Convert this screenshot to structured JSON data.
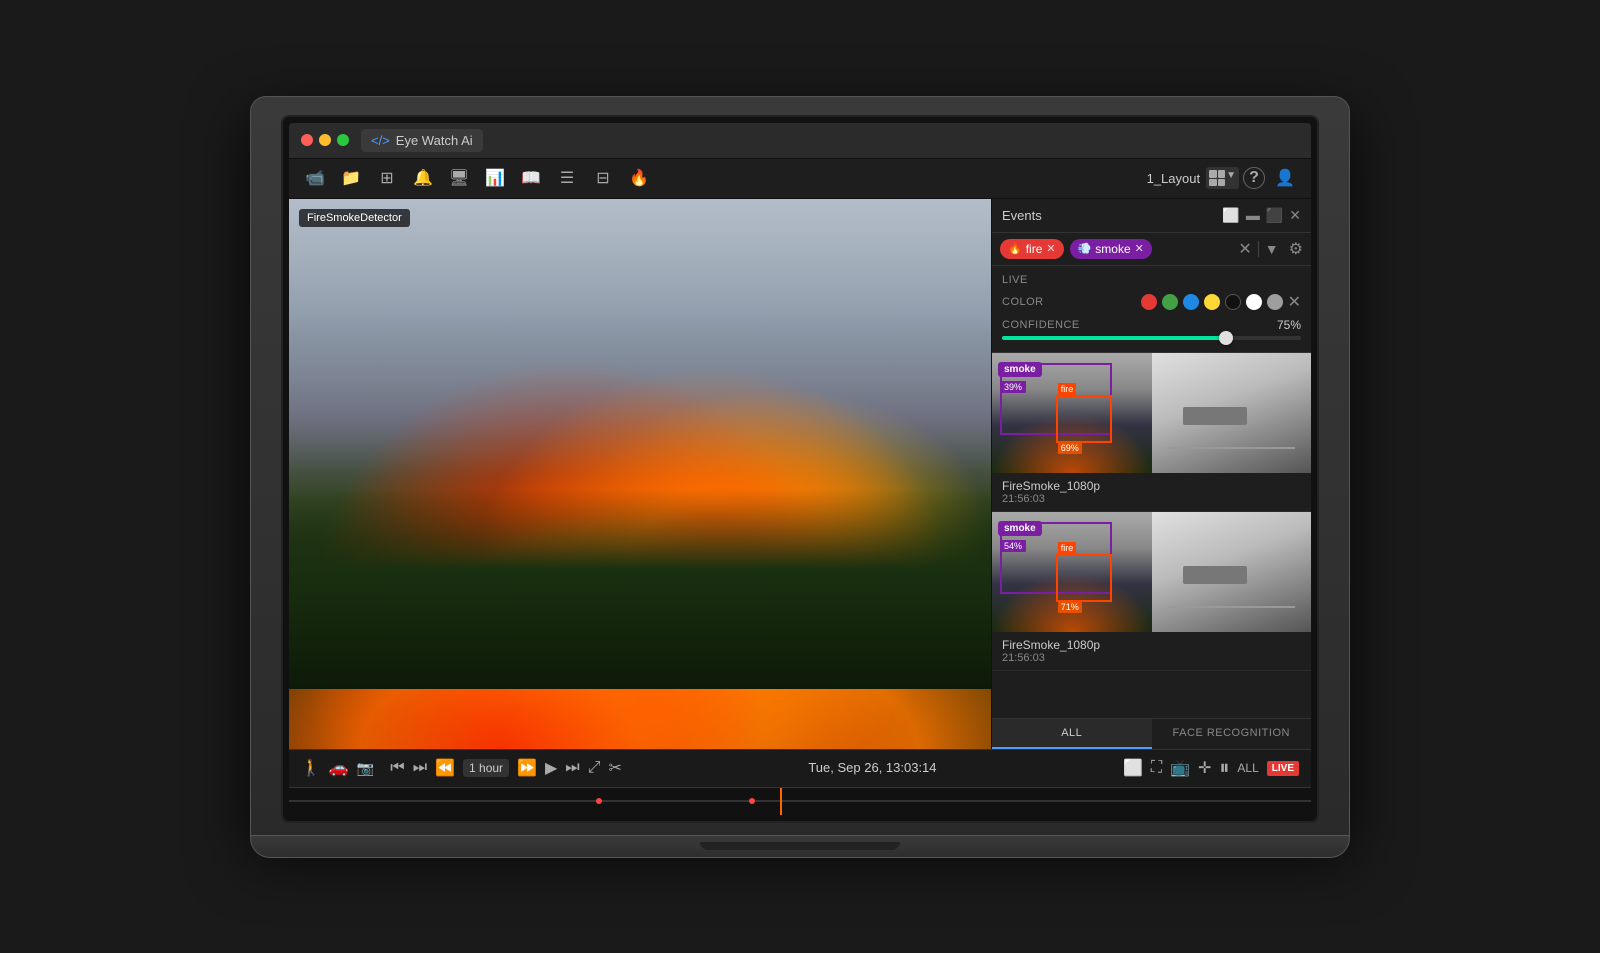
{
  "app": {
    "title": "Eye Watch Ai",
    "title_icon": "</>",
    "traffic_lights": [
      "red",
      "yellow",
      "green"
    ]
  },
  "toolbar": {
    "icons": [
      "camera",
      "folder",
      "grid",
      "bell",
      "display",
      "chart",
      "book",
      "menu",
      "layout",
      "flame"
    ],
    "layout_label": "1_Layout",
    "help_icon": "?",
    "user_icon": "👤"
  },
  "video": {
    "camera_label": "FireSmokeDetector",
    "time_display": "Tue, Sep 26, 13:03:14",
    "playback_speed": "1 hour",
    "live_label": "LIVE",
    "all_label": "ALL"
  },
  "events_panel": {
    "title": "Events",
    "filter_tags": [
      {
        "label": "fire",
        "type": "fire"
      },
      {
        "label": "smoke",
        "type": "smoke"
      }
    ],
    "filters": {
      "live_label": "LIVE",
      "color_label": "COLOR",
      "confidence_label": "CONFIDENCE",
      "confidence_value": "75%",
      "colors": [
        "#e53935",
        "#43a047",
        "#1e88e5",
        "#fdd835",
        "#111111",
        "#ffffff",
        "#9e9e9e"
      ]
    },
    "events": [
      {
        "id": 1,
        "tag": "smoke",
        "tag2": "fire",
        "camera": "FireSmoke_1080p",
        "time": "21:56:03",
        "smoke_conf": "39%",
        "fire_conf": "69%"
      },
      {
        "id": 2,
        "tag": "smoke",
        "tag2": "fire",
        "camera": "FireSmoke_1080p",
        "time": "21:56:03",
        "smoke_conf": "54%",
        "fire_conf": "71%"
      }
    ],
    "tabs": [
      {
        "label": "ALL",
        "active": true
      },
      {
        "label": "FACE RECOGNITION",
        "active": false
      }
    ]
  }
}
